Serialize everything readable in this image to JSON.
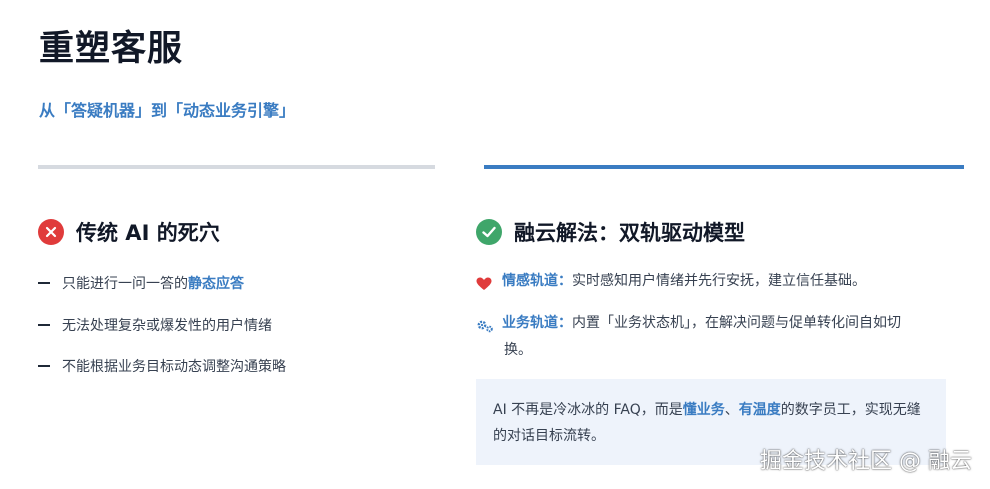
{
  "header": {
    "title": "重塑客服",
    "subtitle": "从「答疑机器」到「动态业务引擎」"
  },
  "left": {
    "heading": "传统 AI 的死穴",
    "icon": "x-circle-icon",
    "items": [
      {
        "text": "只能进行一问一答的",
        "highlight": "静态应答"
      },
      {
        "text": "无法处理复杂或爆发性的用户情绪"
      },
      {
        "text": "不能根据业务目标动态调整沟通策略"
      }
    ]
  },
  "right": {
    "heading": "融云解法：双轨驱动模型",
    "icon": "check-circle-icon",
    "items": [
      {
        "icon": "heart-icon",
        "label": "情感轨道：",
        "text": "实时感知用户情绪并先行安抚，建立信任基础。"
      },
      {
        "icon": "gears-icon",
        "label": "业务轨道：",
        "text": "内置「业务状态机」，在解决问题与促单转化间自如切",
        "cont": "换。"
      }
    ],
    "callout": {
      "prefix": "AI 不再是冷冰冰的 FAQ，而是",
      "hl1": "懂业务",
      "sep": "、",
      "hl2": "有温度",
      "suffix": "的数字员工，实现无缝的对话目标流转。"
    }
  },
  "watermark": "掘金技术社区 @ 融云",
  "colors": {
    "accent": "#3a7cc2",
    "red": "#e03b3b",
    "green": "#3fa66a",
    "callout_bg": "#eef3fb"
  }
}
